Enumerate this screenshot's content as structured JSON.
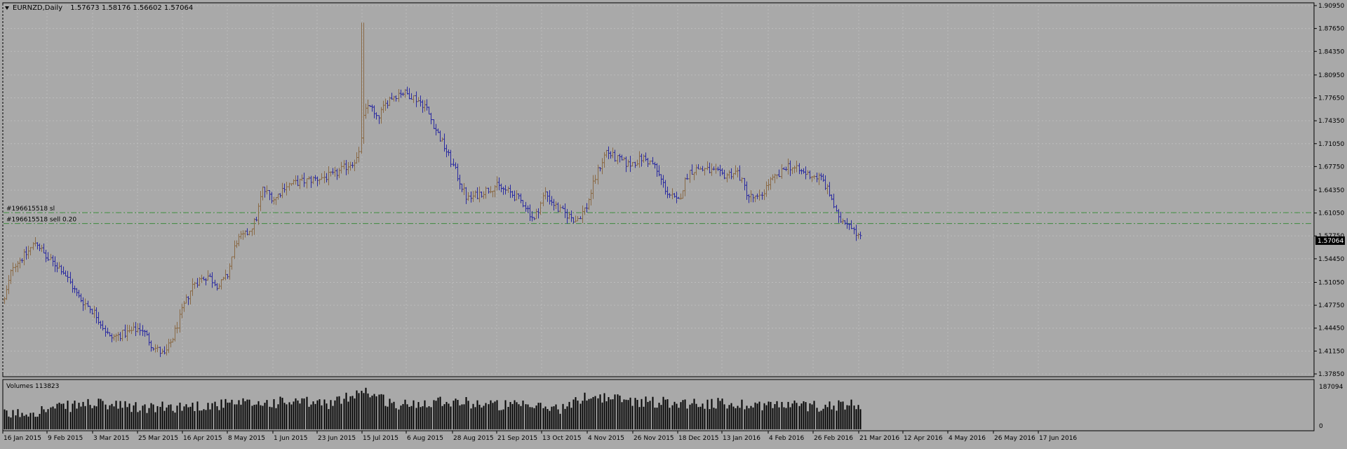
{
  "header": {
    "symbol": "EURNZD,Daily",
    "ohlc": "1.57673 1.58176 1.56602 1.57064"
  },
  "colors": {
    "background": "#a9a9a9",
    "foreground": "#000000",
    "grid": "#bcbcbc",
    "bull": "#8a6a46",
    "bear": "#2a2aa0",
    "order_line": "#3c8a3c",
    "volume": "#000000",
    "price_tag_bg": "#000000",
    "price_tag_fg": "#ffffff"
  },
  "orders": [
    {
      "label": "#196615518 sl",
      "price": 1.611
    },
    {
      "label": "#196615518 sell 0.20",
      "price": 1.5953
    }
  ],
  "volume_panel": {
    "label": "Volumes 113823",
    "axis_top": "187094",
    "axis_bottom": "0"
  },
  "chart_data": {
    "type": "candlestick",
    "symbol": "EURNZD",
    "timeframe": "Daily",
    "y_axis": {
      "min": 1.3785,
      "max": 1.9095,
      "ticks": [
        "1.90950",
        "1.87650",
        "1.84350",
        "1.80950",
        "1.77650",
        "1.74350",
        "1.71050",
        "1.67750",
        "1.64350",
        "1.61050",
        "1.57750",
        "1.54450",
        "1.51050",
        "1.47750",
        "1.44450",
        "1.41150",
        "1.37850"
      ]
    },
    "last_price": "1.57064",
    "x_ticks": [
      "16 Jan 2015",
      "9 Feb 2015",
      "3 Mar 2015",
      "25 Mar 2015",
      "16 Apr 2015",
      "8 May 2015",
      "1 Jun 2015",
      "23 Jun 2015",
      "15 Jul 2015",
      "6 Aug 2015",
      "28 Aug 2015",
      "21 Sep 2015",
      "13 Oct 2015",
      "4 Nov 2015",
      "26 Nov 2015",
      "18 Dec 2015",
      "13 Jan 2016",
      "4 Feb 2016",
      "26 Feb 2016",
      "21 Mar 2016",
      "12 Apr 2016",
      "4 May 2016",
      "26 May 2016",
      "17 Jun 2016"
    ],
    "price_path": [
      [
        0,
        1.485
      ],
      [
        12,
        1.535
      ],
      [
        32,
        1.552
      ],
      [
        45,
        1.57
      ],
      [
        60,
        1.545
      ],
      [
        82,
        1.53
      ],
      [
        105,
        1.49
      ],
      [
        130,
        1.465
      ],
      [
        150,
        1.43
      ],
      [
        175,
        1.438
      ],
      [
        195,
        1.445
      ],
      [
        210,
        1.42
      ],
      [
        228,
        1.405
      ],
      [
        240,
        1.43
      ],
      [
        255,
        1.475
      ],
      [
        270,
        1.51
      ],
      [
        290,
        1.52
      ],
      [
        305,
        1.505
      ],
      [
        318,
        1.52
      ],
      [
        330,
        1.57
      ],
      [
        345,
        1.58
      ],
      [
        358,
        1.6
      ],
      [
        368,
        1.645
      ],
      [
        385,
        1.63
      ],
      [
        400,
        1.65
      ],
      [
        420,
        1.655
      ],
      [
        445,
        1.66
      ],
      [
        470,
        1.665
      ],
      [
        490,
        1.68
      ],
      [
        505,
        1.69
      ],
      [
        512,
        1.75
      ],
      [
        520,
        1.77
      ],
      [
        530,
        1.745
      ],
      [
        548,
        1.775
      ],
      [
        565,
        1.785
      ],
      [
        580,
        1.78
      ],
      [
        600,
        1.765
      ],
      [
        615,
        1.73
      ],
      [
        630,
        1.7
      ],
      [
        643,
        1.67
      ],
      [
        660,
        1.63
      ],
      [
        680,
        1.64
      ],
      [
        700,
        1.65
      ],
      [
        720,
        1.64
      ],
      [
        740,
        1.625
      ],
      [
        755,
        1.6
      ],
      [
        770,
        1.64
      ],
      [
        790,
        1.615
      ],
      [
        815,
        1.6
      ],
      [
        830,
        1.62
      ],
      [
        845,
        1.67
      ],
      [
        858,
        1.7
      ],
      [
        870,
        1.69
      ],
      [
        890,
        1.68
      ],
      [
        910,
        1.69
      ],
      [
        925,
        1.68
      ],
      [
        945,
        1.64
      ],
      [
        960,
        1.625
      ],
      [
        975,
        1.67
      ],
      [
        990,
        1.675
      ],
      [
        1010,
        1.67
      ],
      [
        1025,
        1.665
      ],
      [
        1045,
        1.67
      ],
      [
        1060,
        1.635
      ],
      [
        1075,
        1.63
      ],
      [
        1090,
        1.655
      ],
      [
        1105,
        1.665
      ],
      [
        1115,
        1.68
      ],
      [
        1135,
        1.67
      ],
      [
        1150,
        1.665
      ],
      [
        1165,
        1.66
      ],
      [
        1180,
        1.63
      ],
      [
        1188,
        1.6
      ],
      [
        1200,
        1.6
      ],
      [
        1210,
        1.59
      ],
      [
        1220,
        1.573
      ]
    ],
    "volume_path": [
      [
        0,
        0.3
      ],
      [
        60,
        0.42
      ],
      [
        120,
        0.55
      ],
      [
        200,
        0.45
      ],
      [
        300,
        0.52
      ],
      [
        400,
        0.58
      ],
      [
        470,
        0.55
      ],
      [
        510,
        0.85
      ],
      [
        560,
        0.5
      ],
      [
        620,
        0.62
      ],
      [
        700,
        0.52
      ],
      [
        760,
        0.48
      ],
      [
        800,
        0.45
      ],
      [
        830,
        0.72
      ],
      [
        900,
        0.6
      ],
      [
        1000,
        0.55
      ],
      [
        1100,
        0.52
      ],
      [
        1160,
        0.5
      ],
      [
        1220,
        0.55
      ]
    ],
    "volume_max": 187094
  }
}
